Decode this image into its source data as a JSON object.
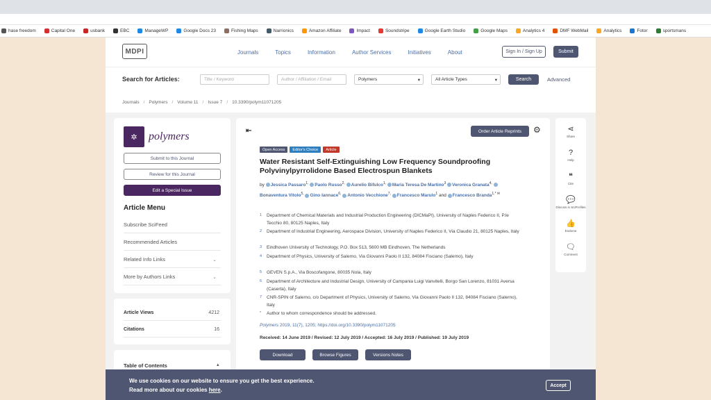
{
  "bookmarks": [
    {
      "label": "hase freedom",
      "color": "#555"
    },
    {
      "label": "Capital One",
      "color": "#d32f2f"
    },
    {
      "label": "usbank",
      "color": "#c62828"
    },
    {
      "label": "EBC",
      "color": "#333"
    },
    {
      "label": "ManageWP",
      "color": "#1e88e5"
    },
    {
      "label": "Google Docs 23",
      "color": "#1e88e5"
    },
    {
      "label": "Fishing Maps",
      "color": "#8d6e63"
    },
    {
      "label": "Narrionics",
      "color": "#455a64"
    },
    {
      "label": "Amazon Affiliate",
      "color": "#ff9800"
    },
    {
      "label": "Impact",
      "color": "#7e57c2"
    },
    {
      "label": "Soundstripe",
      "color": "#e53935"
    },
    {
      "label": "Google Earth Studio",
      "color": "#1e88e5"
    },
    {
      "label": "Google Maps",
      "color": "#43a047"
    },
    {
      "label": "Analytics 4",
      "color": "#f9a825"
    },
    {
      "label": "DMF WebMail",
      "color": "#e65100"
    },
    {
      "label": "Analytics",
      "color": "#f9a825"
    },
    {
      "label": "Fotor",
      "color": "#1976d2"
    },
    {
      "label": "sportsmans",
      "color": "#2e7d32"
    }
  ],
  "header": {
    "logo": "MDPI",
    "nav": [
      "Journals",
      "Topics",
      "Information",
      "Author Services",
      "Initiatives",
      "About"
    ],
    "signin": "Sign In / Sign Up",
    "submit": "Submit"
  },
  "search": {
    "label": "Search for Articles:",
    "title_placeholder": "Title / Keyword",
    "author_placeholder": "Author / Affiliation / Email",
    "journal_value": "Polymers",
    "type_value": "All Article Types",
    "button": "Search",
    "advanced": "Advanced"
  },
  "breadcrumbs": [
    "Journals",
    "Polymers",
    "Volume 11",
    "Issue 7",
    "10.3390/polym11071205"
  ],
  "sidebar": {
    "journal_name": "polymers",
    "submit_journal": "Submit to this Journal",
    "review_journal": "Review for this Journal",
    "edit_special": "Edit a Special Issue",
    "menu_title": "Article Menu",
    "menu_items": [
      {
        "label": "Subscribe SciFeed",
        "chevron": ""
      },
      {
        "label": "Recommended Articles",
        "chevron": ""
      },
      {
        "label": "Related Info Links",
        "chevron": "⌄"
      },
      {
        "label": "More by Authors Links",
        "chevron": "⌄"
      }
    ],
    "stats": [
      {
        "label": "Article Views",
        "value": "4212"
      },
      {
        "label": "Citations",
        "value": "16"
      }
    ],
    "toc_title": "Table of Contents"
  },
  "article": {
    "reprints": "Order Article Reprints",
    "badges": [
      {
        "label": "Open Access",
        "color": "#4f5671"
      },
      {
        "label": "Editor's Choice",
        "color": "#2f7fbf"
      },
      {
        "label": "Article",
        "color": "#c0392b"
      }
    ],
    "title": "Water Resistant Self-Extinguishing Low Frequency Soundproofing Polyvinylpyrrolidone Based Electrospun Blankets",
    "authors_prefix": "by",
    "authors": [
      {
        "name": "Jessica Passaro",
        "sup": "1,"
      },
      {
        "name": "Paolo Russo",
        "sup": "2,"
      },
      {
        "name": "Aurelio Bifulco",
        "sup": "1,"
      },
      {
        "name": "Maria Teresa De Martino",
        "sup": "3"
      },
      {
        "name": "Veronica Granata",
        "sup": "4,"
      },
      {
        "name": "Bonaventura Vitolo",
        "sup": "5,"
      },
      {
        "name": "Gino Iannace",
        "sup": "6,"
      },
      {
        "name": "Antonio Vecchione",
        "sup": "7,"
      },
      {
        "name": "Francesco Marulo",
        "sup": "1"
      },
      {
        "name": "Francesco Branda",
        "sup": "1,* ✉"
      }
    ],
    "authors_and": "and",
    "affiliations": [
      {
        "num": "1",
        "text": "Department of Chemical Materials and Industrial Production Engineering (DICMaPI), University of Naples Federico II, P.le Tecchio 80, 80125 Naples, Italy"
      },
      {
        "num": "2",
        "text": "Department of Industrial Engineering, Aerospace Division, University of Naples Federico II, Via Claudio 21, 80125 Naples, Italy"
      },
      {
        "num": "3",
        "text": "Eindhoven University of Technology, P.O. Box 513, 5600 MB Eindhoven, The Netherlands"
      },
      {
        "num": "4",
        "text": "Department of Physics, University of Salerno, Via Giovanni Paolo II 132, 84084 Fisciano (Salerno), Italy"
      },
      {
        "num": "5",
        "text": "GEVEN S.p.A., Via Boscofangone, 80035 Nola, Italy"
      },
      {
        "num": "6",
        "text": "Department of Architecture and Industrial Design, University of Campania Luigi Vanvitelli, Borgo San Lorenzo, 81031 Aversa (Caserta), Italy"
      },
      {
        "num": "7",
        "text": "CNR-SPIN of Salerno, c/o Department of Physics, University of Salerno, Via Giovanni Paolo II 132, 84084 Fisciano (Salerno), Italy"
      },
      {
        "num": "*",
        "text": "Author to whom correspondence should be addressed."
      }
    ],
    "citation_journal": "Polymers",
    "citation_rest": "2019, 11(7), 1205; https://doi.org/10.3390/polym11071205",
    "dates": "Received: 14 June 2019 / Revised: 12 July 2019 / Accepted: 16 July 2019 / Published: 19 July 2019",
    "buttons": {
      "download": "Download",
      "browse": "Browse Figures",
      "versions": "Versions Notes"
    }
  },
  "tools": [
    {
      "icon": "share-icon",
      "glyph": "⋖",
      "label": "Share"
    },
    {
      "icon": "help-icon",
      "glyph": "?",
      "label": "Help"
    },
    {
      "icon": "cite-icon",
      "glyph": "❝",
      "label": "Cite"
    },
    {
      "icon": "discuss-icon",
      "glyph": "💬",
      "label": "Discuss in SciProfiles"
    },
    {
      "icon": "endorse-icon",
      "glyph": "👍",
      "label": "Endorse"
    },
    {
      "icon": "comment-icon",
      "glyph": "🗨",
      "label": "Comment"
    }
  ],
  "cookie": {
    "line1": "We use cookies on our website to ensure you get the best experience.",
    "line2_prefix": "Read more about our cookies",
    "line2_link": "here",
    "accept": "Accept"
  }
}
